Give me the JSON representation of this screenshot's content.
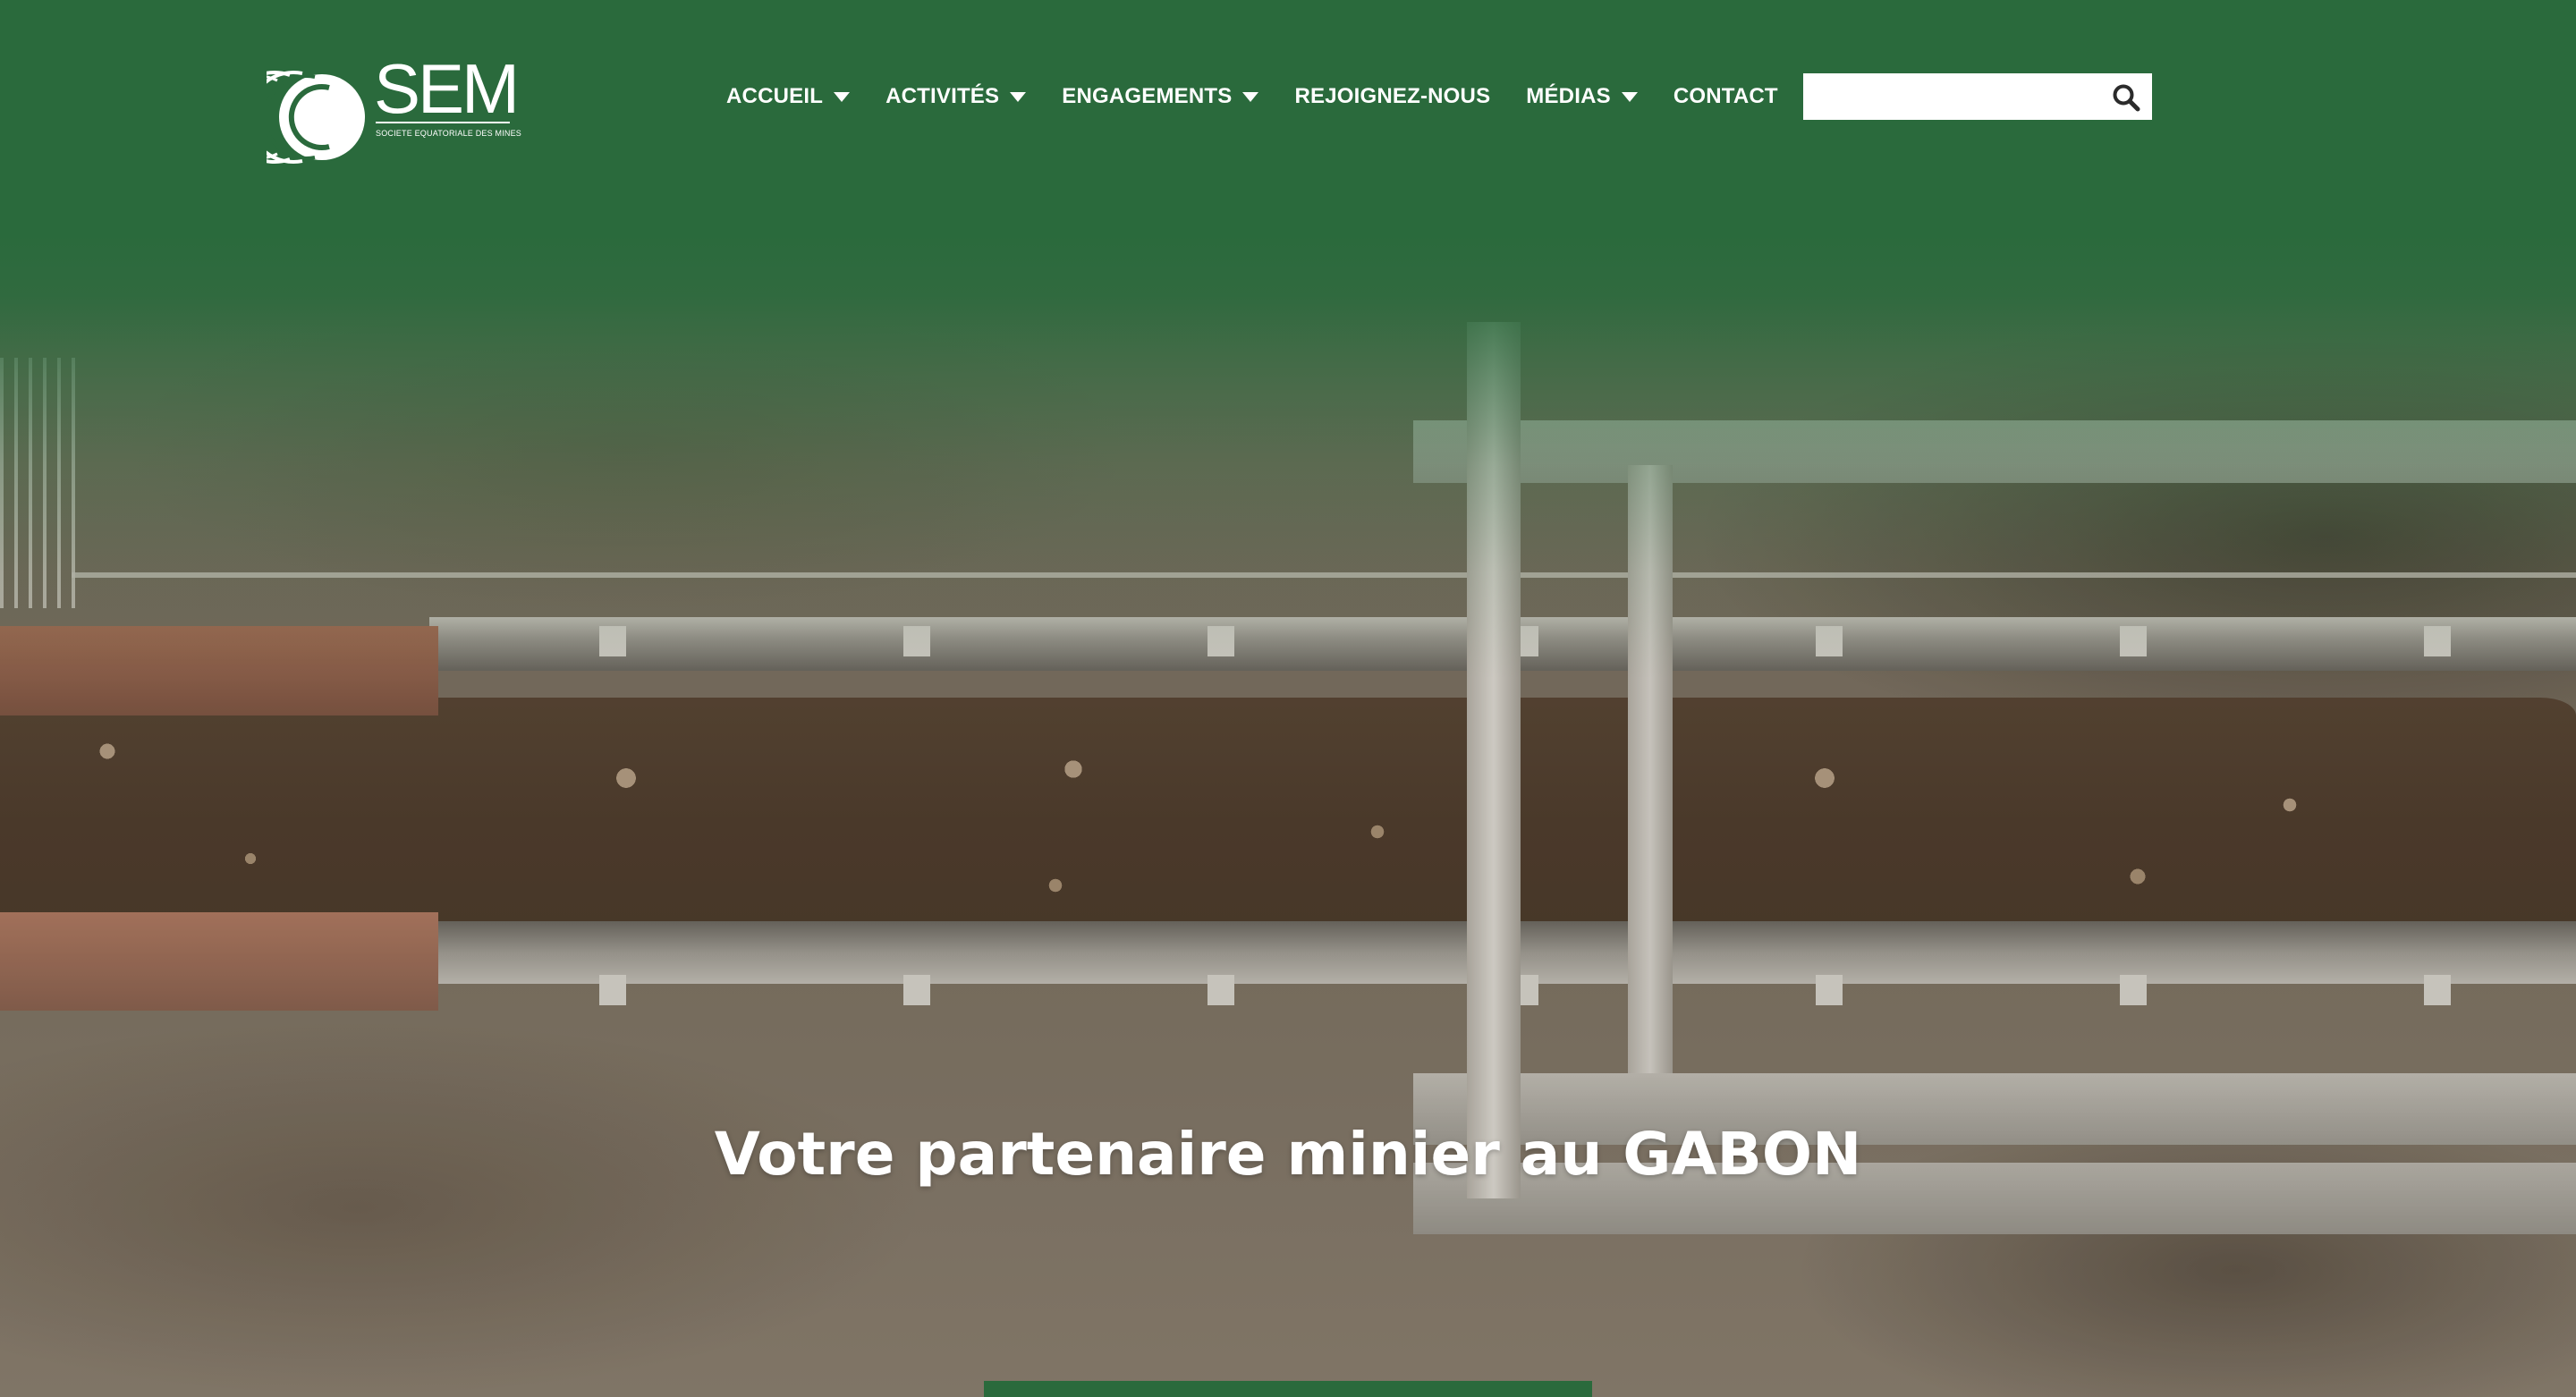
{
  "brand": {
    "name": "SEM",
    "tagline": "SOCIETE EQUATORIALE DES MINES",
    "color": "#2a6a3c"
  },
  "nav": {
    "items": [
      {
        "label": "ACCUEIL",
        "has_dropdown": true
      },
      {
        "label": "ACTIVITÉS",
        "has_dropdown": true
      },
      {
        "label": "ENGAGEMENTS",
        "has_dropdown": true
      },
      {
        "label": "REJOIGNEZ-NOUS",
        "has_dropdown": false
      },
      {
        "label": "MÉDIAS",
        "has_dropdown": true
      },
      {
        "label": "CONTACT",
        "has_dropdown": false
      }
    ]
  },
  "search": {
    "value": "",
    "placeholder": "",
    "icon": "search-icon"
  },
  "hero": {
    "title": "Votre partenaire minier au GABON",
    "background": "conveyor-belt-photo"
  }
}
